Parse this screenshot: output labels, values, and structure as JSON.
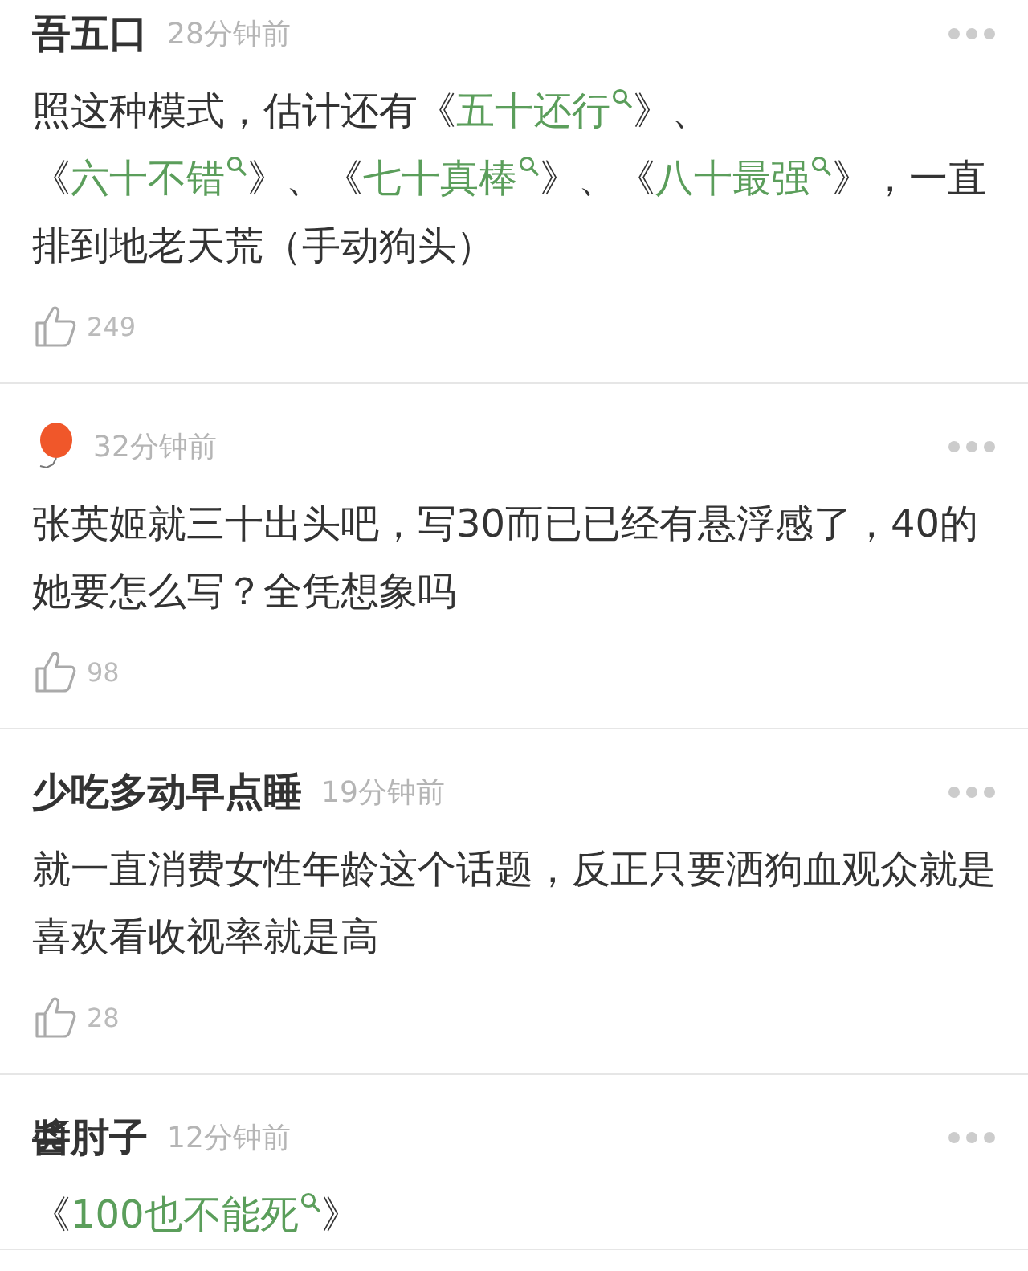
{
  "comments": [
    {
      "author": {
        "kind": "name",
        "name": "吾五口"
      },
      "time": "28分钟前",
      "body": [
        {
          "text": "照这种模式，估计还有《"
        },
        {
          "text": "五十还行",
          "link": true
        },
        {
          "text": "》、《"
        },
        {
          "text": "六十不错",
          "link": true
        },
        {
          "text": "》、《"
        },
        {
          "text": "七十真棒",
          "link": true
        },
        {
          "text": "》、《"
        },
        {
          "text": "八十最强",
          "link": true
        },
        {
          "text": "》，一直排到地老天荒（手动狗头）"
        }
      ],
      "likes": "249"
    },
    {
      "author": {
        "kind": "balloon"
      },
      "time": "32分钟前",
      "body": [
        {
          "text": "张英姬就三十出头吧，写30而已已经有悬浮感了，40的她要怎么写？全凭想象吗"
        }
      ],
      "likes": "98"
    },
    {
      "author": {
        "kind": "name",
        "name": "少吃多动早点睡"
      },
      "time": "19分钟前",
      "body": [
        {
          "text": "就一直消费女性年龄这个话题，反正只要洒狗血观众就是喜欢看收视率就是高"
        }
      ],
      "likes": "28"
    },
    {
      "author": {
        "kind": "name",
        "name": "醬肘子"
      },
      "time": "12分钟前",
      "body": [
        {
          "text": "《"
        },
        {
          "text": "100也不能死",
          "link": true
        },
        {
          "text": "》"
        }
      ]
    }
  ]
}
